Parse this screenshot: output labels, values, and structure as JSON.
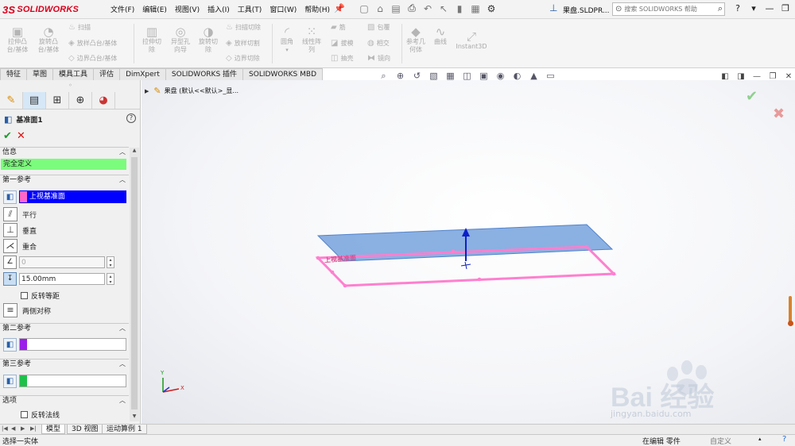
{
  "app": {
    "brand": "SOLIDWORKS",
    "brand_prefix": "3S",
    "document": "果盘.SLDPR..."
  },
  "menu": [
    "文件(F)",
    "编辑(E)",
    "视图(V)",
    "插入(I)",
    "工具(T)",
    "窗口(W)",
    "帮助(H)"
  ],
  "search": {
    "placeholder": "搜索 SOLIDWORKS 帮助"
  },
  "ribbon": {
    "extrude_boss": "拉伸凸\n台/基体",
    "revolve_boss": "旋转凸\n台/基体",
    "sweep": "扫描",
    "loft_boss": "放样凸台/基体",
    "boundary_boss": "边界凸台/基体",
    "extrude_cut": "拉伸切\n除",
    "hole_wizard": "异型孔\n向导",
    "revolve_cut": "旋转切\n除",
    "swept_cut": "扫描切除",
    "lofted_cut": "放样切割",
    "boundary_cut": "边界切除",
    "fillet": "圆角",
    "linear_pattern": "线性阵\n列",
    "rib": "筋",
    "draft": "拔模",
    "shell": "抽壳",
    "wrap": "包覆",
    "intersect": "相交",
    "mirror": "镜向",
    "ref_geometry": "参考几\n何体",
    "curves": "曲线",
    "instant3d": "Instant3D"
  },
  "tabs": [
    "特征",
    "草图",
    "模具工具",
    "评估",
    "DimXpert",
    "SOLIDWORKS 插件",
    "SOLIDWORKS MBD"
  ],
  "property_manager": {
    "title": "基准面1",
    "info_header": "信息",
    "status": "完全定义",
    "first_ref": {
      "header": "第一参考",
      "selection": "上视基准面",
      "swatch_color": "#ff66cc",
      "options": [
        "平行",
        "垂直",
        "重合"
      ],
      "angle": "0",
      "distance": "15.00mm",
      "flip_offset": "反转等距",
      "mid_plane": "两侧对称"
    },
    "second_ref": {
      "header": "第二参考",
      "swatch_color": "#9b1fe8"
    },
    "third_ref": {
      "header": "第三参考",
      "swatch_color": "#1fc04a"
    },
    "options": {
      "header": "选项",
      "flip_normal": "反转法线"
    }
  },
  "viewport": {
    "tree_root": "果盘 (默认<<默认>_显...",
    "plane_label": "上视基准面",
    "plane_fill": "#7fa8e0",
    "preview_color": "#ff7fcf",
    "watermark": "Bai 经验",
    "watermark_url": "jingyan.baidu.com"
  },
  "bottom_tabs": [
    "模型",
    "3D 视图",
    "运动算例 1"
  ],
  "statusbar": {
    "left": "选择一实体",
    "mode": "在编辑 零件",
    "custom": "自定义"
  }
}
